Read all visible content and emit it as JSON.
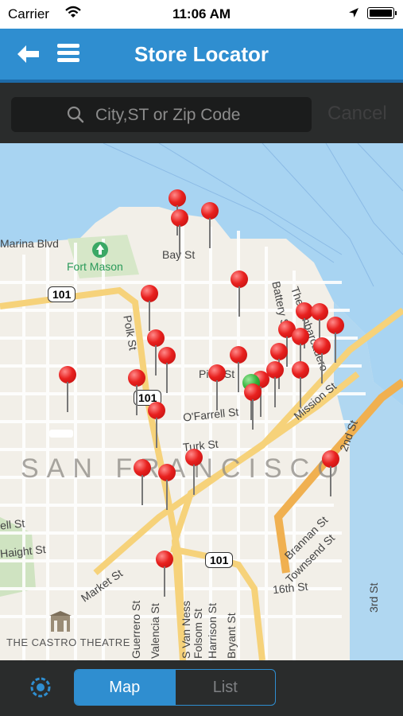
{
  "status": {
    "carrier": "Carrier",
    "time": "11:06 AM"
  },
  "navbar": {
    "title": "Store Locator",
    "icons": [
      "back-arrow-icon",
      "menu-icon"
    ]
  },
  "search": {
    "placeholder": "City,ST or Zip Code",
    "cancel": "Cancel"
  },
  "map": {
    "poi": "Fort Mason",
    "city": "SAN FRANCISCO",
    "landmark": "THE CASTRO THEATRE",
    "route_shields": [
      "101",
      "101",
      "101"
    ],
    "streets": [
      "Bay St",
      "Marina Blvd",
      "Polk St",
      "Pine St",
      "O'Farrell St",
      "Turk St",
      "Market St",
      "Haight St",
      "ell St",
      "16th St",
      "Battery St",
      "The Embarcadero",
      "Mission St",
      "2nd St",
      "Brannan St",
      "Townsend St",
      "Guerrero St",
      "Valencia St",
      "S Van Ness",
      "Folsom St",
      "Harrison St",
      "Bryant St",
      "3rd St"
    ],
    "pins": {
      "red": 28,
      "green": 1
    }
  },
  "tabbar": {
    "map": "Map",
    "list": "List"
  }
}
